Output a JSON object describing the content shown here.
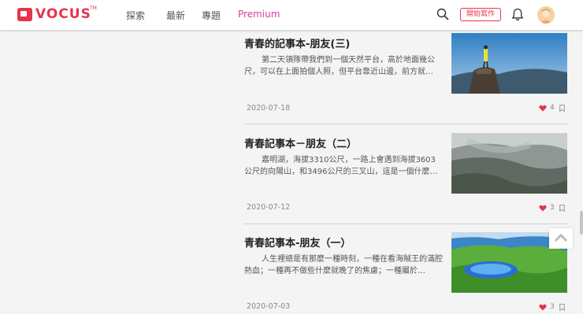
{
  "header": {
    "logo_text": "VOCUS",
    "logo_tm": "TM",
    "nav": [
      "探索",
      "最新",
      "專題",
      "Premium"
    ],
    "write_button": "開始寫作",
    "brand_color": "#e6344a",
    "premium_color": "#d63aa0"
  },
  "articles": [
    {
      "title": "青春的記事本-朋友(三)",
      "excerpt": "第二天領隊帶我們到一個天然平台，高於地面幾公尺，可以在上面拍個人照，但平台靠近山邊，前方就…",
      "date": "2020-07-18",
      "likes": "4",
      "thumb": "person-on-rock-peak"
    },
    {
      "title": "青春記事本－朋友（二）",
      "excerpt": "嘉明湖，海拔3310公尺，一路上會遇到海拔3603公尺的向陽山，和3496公尺的三叉山，這是一個什麼…",
      "date": "2020-07-12",
      "likes": "3",
      "thumb": "misty-mountain-slope"
    },
    {
      "title": "青春記事本-朋友（一）",
      "excerpt": "人生裡總是有那麼一種時刻，一種在看海賊王的滿腔熱血；一種再不做些什麼就晚了的焦慮；一種屬於…",
      "date": "2020-07-03",
      "likes": "3",
      "thumb": "blue-lake-green-hills"
    }
  ]
}
